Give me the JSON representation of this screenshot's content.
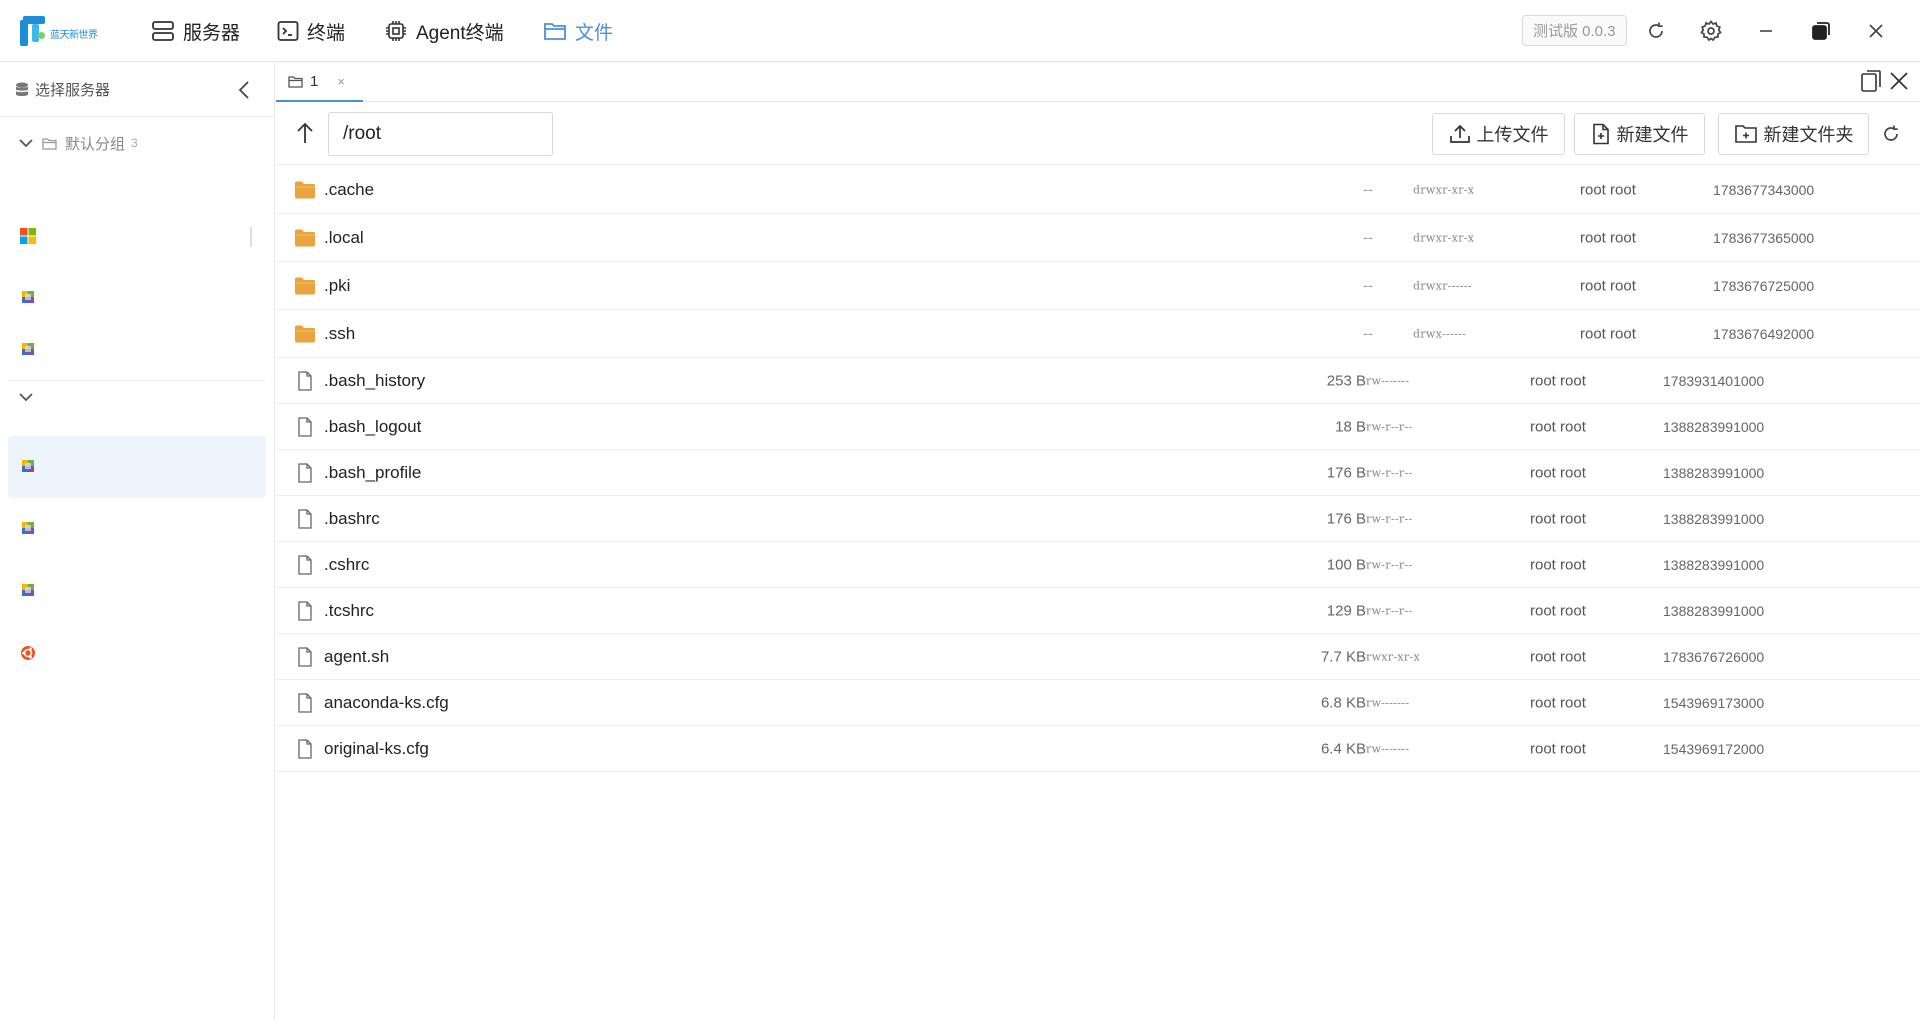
{
  "app": {
    "logo_text": "蓝天新世界",
    "nav": [
      {
        "label": "服务器",
        "icon": "server-icon"
      },
      {
        "label": "终端",
        "icon": "terminal-icon"
      },
      {
        "label": "Agent终端",
        "icon": "chip-icon"
      },
      {
        "label": "文件",
        "icon": "folder-icon",
        "active": true
      }
    ],
    "version": "测试版 0.0.3",
    "accent_color": "#4a90d9"
  },
  "sidebar": {
    "title": "选择服务器",
    "group": {
      "label": "默认分组",
      "count": "3"
    },
    "servers": [
      {
        "icon": "windows-icon"
      },
      {
        "icon": "linux-icon"
      },
      {
        "icon": "linux-icon"
      },
      {
        "icon": "linux-icon",
        "selected": true
      },
      {
        "icon": "linux-icon"
      },
      {
        "icon": "linux-icon"
      },
      {
        "icon": "ubuntu-icon"
      }
    ]
  },
  "tabs": [
    {
      "label": "1",
      "close": "×"
    }
  ],
  "toolbar": {
    "path": "/root",
    "upload_label": "上传文件",
    "new_file_label": "新建文件",
    "new_folder_label": "新建文件夹"
  },
  "files": [
    {
      "type": "dir",
      "name": ".cache",
      "size": "--",
      "perm": "drwxr-xr-x",
      "owner": "root root",
      "mtime": "1783677343000"
    },
    {
      "type": "dir",
      "name": ".local",
      "size": "--",
      "perm": "drwxr-xr-x",
      "owner": "root root",
      "mtime": "1783677365000"
    },
    {
      "type": "dir",
      "name": ".pki",
      "size": "--",
      "perm": "drwxr------",
      "owner": "root root",
      "mtime": "1783676725000"
    },
    {
      "type": "dir",
      "name": ".ssh",
      "size": "--",
      "perm": "drwx------",
      "owner": "root root",
      "mtime": "1783676492000"
    },
    {
      "type": "file",
      "name": ".bash_history",
      "size": "253 B",
      "perm": "-rw-------",
      "owner": "root root",
      "mtime": "1783931401000"
    },
    {
      "type": "file",
      "name": ".bash_logout",
      "size": "18 B",
      "perm": "-rw-r--r--",
      "owner": "root root",
      "mtime": "1388283991000"
    },
    {
      "type": "file",
      "name": ".bash_profile",
      "size": "176 B",
      "perm": "-rw-r--r--",
      "owner": "root root",
      "mtime": "1388283991000"
    },
    {
      "type": "file",
      "name": ".bashrc",
      "size": "176 B",
      "perm": "-rw-r--r--",
      "owner": "root root",
      "mtime": "1388283991000"
    },
    {
      "type": "file",
      "name": ".cshrc",
      "size": "100 B",
      "perm": "-rw-r--r--",
      "owner": "root root",
      "mtime": "1388283991000"
    },
    {
      "type": "file",
      "name": ".tcshrc",
      "size": "129 B",
      "perm": "-rw-r--r--",
      "owner": "root root",
      "mtime": "1388283991000"
    },
    {
      "type": "file",
      "name": "agent.sh",
      "size": "7.7 KB",
      "perm": "-rwxr-xr-x",
      "owner": "root root",
      "mtime": "1783676726000"
    },
    {
      "type": "file",
      "name": "anaconda-ks.cfg",
      "size": "6.8 KB",
      "perm": "-rw-------",
      "owner": "root root",
      "mtime": "1543969173000"
    },
    {
      "type": "file",
      "name": "original-ks.cfg",
      "size": "6.4 KB",
      "perm": "-rw-------",
      "owner": "root root",
      "mtime": "1543969172000"
    }
  ]
}
